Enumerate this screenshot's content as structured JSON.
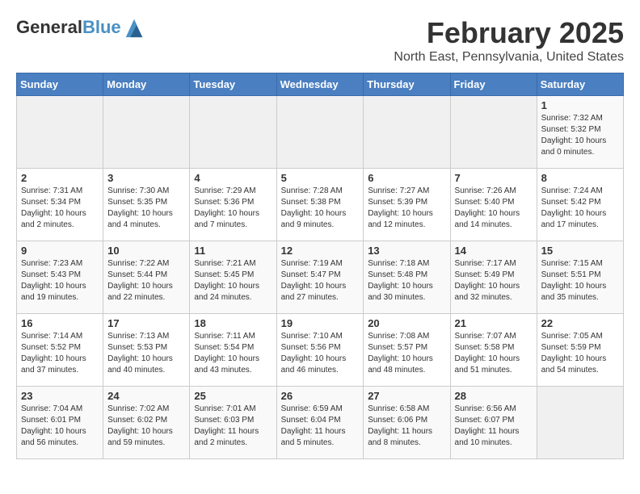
{
  "header": {
    "logo_general": "General",
    "logo_blue": "Blue",
    "main_title": "February 2025",
    "subtitle": "North East, Pennsylvania, United States"
  },
  "weekdays": [
    "Sunday",
    "Monday",
    "Tuesday",
    "Wednesday",
    "Thursday",
    "Friday",
    "Saturday"
  ],
  "weeks": [
    [
      {
        "day": "",
        "detail": ""
      },
      {
        "day": "",
        "detail": ""
      },
      {
        "day": "",
        "detail": ""
      },
      {
        "day": "",
        "detail": ""
      },
      {
        "day": "",
        "detail": ""
      },
      {
        "day": "",
        "detail": ""
      },
      {
        "day": "1",
        "detail": "Sunrise: 7:32 AM\nSunset: 5:32 PM\nDaylight: 10 hours and 0 minutes."
      }
    ],
    [
      {
        "day": "2",
        "detail": "Sunrise: 7:31 AM\nSunset: 5:34 PM\nDaylight: 10 hours and 2 minutes."
      },
      {
        "day": "3",
        "detail": "Sunrise: 7:30 AM\nSunset: 5:35 PM\nDaylight: 10 hours and 4 minutes."
      },
      {
        "day": "4",
        "detail": "Sunrise: 7:29 AM\nSunset: 5:36 PM\nDaylight: 10 hours and 7 minutes."
      },
      {
        "day": "5",
        "detail": "Sunrise: 7:28 AM\nSunset: 5:38 PM\nDaylight: 10 hours and 9 minutes."
      },
      {
        "day": "6",
        "detail": "Sunrise: 7:27 AM\nSunset: 5:39 PM\nDaylight: 10 hours and 12 minutes."
      },
      {
        "day": "7",
        "detail": "Sunrise: 7:26 AM\nSunset: 5:40 PM\nDaylight: 10 hours and 14 minutes."
      },
      {
        "day": "8",
        "detail": "Sunrise: 7:24 AM\nSunset: 5:42 PM\nDaylight: 10 hours and 17 minutes."
      }
    ],
    [
      {
        "day": "9",
        "detail": "Sunrise: 7:23 AM\nSunset: 5:43 PM\nDaylight: 10 hours and 19 minutes."
      },
      {
        "day": "10",
        "detail": "Sunrise: 7:22 AM\nSunset: 5:44 PM\nDaylight: 10 hours and 22 minutes."
      },
      {
        "day": "11",
        "detail": "Sunrise: 7:21 AM\nSunset: 5:45 PM\nDaylight: 10 hours and 24 minutes."
      },
      {
        "day": "12",
        "detail": "Sunrise: 7:19 AM\nSunset: 5:47 PM\nDaylight: 10 hours and 27 minutes."
      },
      {
        "day": "13",
        "detail": "Sunrise: 7:18 AM\nSunset: 5:48 PM\nDaylight: 10 hours and 30 minutes."
      },
      {
        "day": "14",
        "detail": "Sunrise: 7:17 AM\nSunset: 5:49 PM\nDaylight: 10 hours and 32 minutes."
      },
      {
        "day": "15",
        "detail": "Sunrise: 7:15 AM\nSunset: 5:51 PM\nDaylight: 10 hours and 35 minutes."
      }
    ],
    [
      {
        "day": "16",
        "detail": "Sunrise: 7:14 AM\nSunset: 5:52 PM\nDaylight: 10 hours and 37 minutes."
      },
      {
        "day": "17",
        "detail": "Sunrise: 7:13 AM\nSunset: 5:53 PM\nDaylight: 10 hours and 40 minutes."
      },
      {
        "day": "18",
        "detail": "Sunrise: 7:11 AM\nSunset: 5:54 PM\nDaylight: 10 hours and 43 minutes."
      },
      {
        "day": "19",
        "detail": "Sunrise: 7:10 AM\nSunset: 5:56 PM\nDaylight: 10 hours and 46 minutes."
      },
      {
        "day": "20",
        "detail": "Sunrise: 7:08 AM\nSunset: 5:57 PM\nDaylight: 10 hours and 48 minutes."
      },
      {
        "day": "21",
        "detail": "Sunrise: 7:07 AM\nSunset: 5:58 PM\nDaylight: 10 hours and 51 minutes."
      },
      {
        "day": "22",
        "detail": "Sunrise: 7:05 AM\nSunset: 5:59 PM\nDaylight: 10 hours and 54 minutes."
      }
    ],
    [
      {
        "day": "23",
        "detail": "Sunrise: 7:04 AM\nSunset: 6:01 PM\nDaylight: 10 hours and 56 minutes."
      },
      {
        "day": "24",
        "detail": "Sunrise: 7:02 AM\nSunset: 6:02 PM\nDaylight: 10 hours and 59 minutes."
      },
      {
        "day": "25",
        "detail": "Sunrise: 7:01 AM\nSunset: 6:03 PM\nDaylight: 11 hours and 2 minutes."
      },
      {
        "day": "26",
        "detail": "Sunrise: 6:59 AM\nSunset: 6:04 PM\nDaylight: 11 hours and 5 minutes."
      },
      {
        "day": "27",
        "detail": "Sunrise: 6:58 AM\nSunset: 6:06 PM\nDaylight: 11 hours and 8 minutes."
      },
      {
        "day": "28",
        "detail": "Sunrise: 6:56 AM\nSunset: 6:07 PM\nDaylight: 11 hours and 10 minutes."
      },
      {
        "day": "",
        "detail": ""
      }
    ]
  ]
}
